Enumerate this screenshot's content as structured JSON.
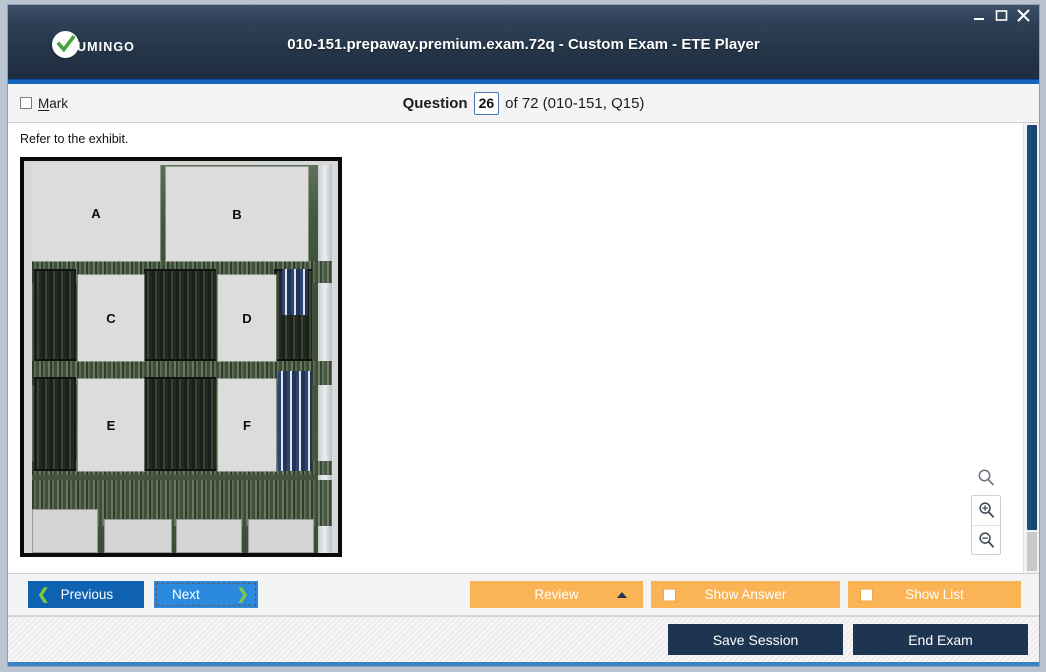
{
  "window": {
    "title": "010-151.prepaway.premium.exam.72q - Custom Exam - ETE Player",
    "logo_text": "UMINGO",
    "controls": {
      "minimize": "minimize-icon",
      "maximize": "maximize-icon",
      "close": "close-icon"
    }
  },
  "question_bar": {
    "mark_label_prefix": "M",
    "mark_label_rest": "ark",
    "question_word": "Question",
    "question_number": "26",
    "question_of": "of 72 (010-151, Q15)"
  },
  "content": {
    "prompt": "Refer to the exhibit.",
    "exhibit": {
      "alt": "server-motherboard-photo",
      "callouts": [
        "A",
        "B",
        "C",
        "D",
        "E",
        "F"
      ]
    },
    "zoom_tools": {
      "search": "magnifier-icon",
      "zoom_in": "zoom-in-icon",
      "zoom_out": "zoom-out-icon"
    }
  },
  "nav_bar": {
    "previous": "Previous",
    "next": "Next",
    "review": "Review",
    "show_answer": "Show Answer",
    "show_list": "Show List"
  },
  "footer": {
    "save_session": "Save Session",
    "end_exam": "End Exam"
  },
  "colors": {
    "titlebar_dark": "#253548",
    "accent_blue": "#1565c0",
    "primary_blue": "#0e62b0",
    "next_blue": "#2b8ade",
    "orange": "#fab455",
    "navy": "#1d3550",
    "green_chevron": "#7ac943",
    "scroll_thumb": "#1d4e7e"
  }
}
